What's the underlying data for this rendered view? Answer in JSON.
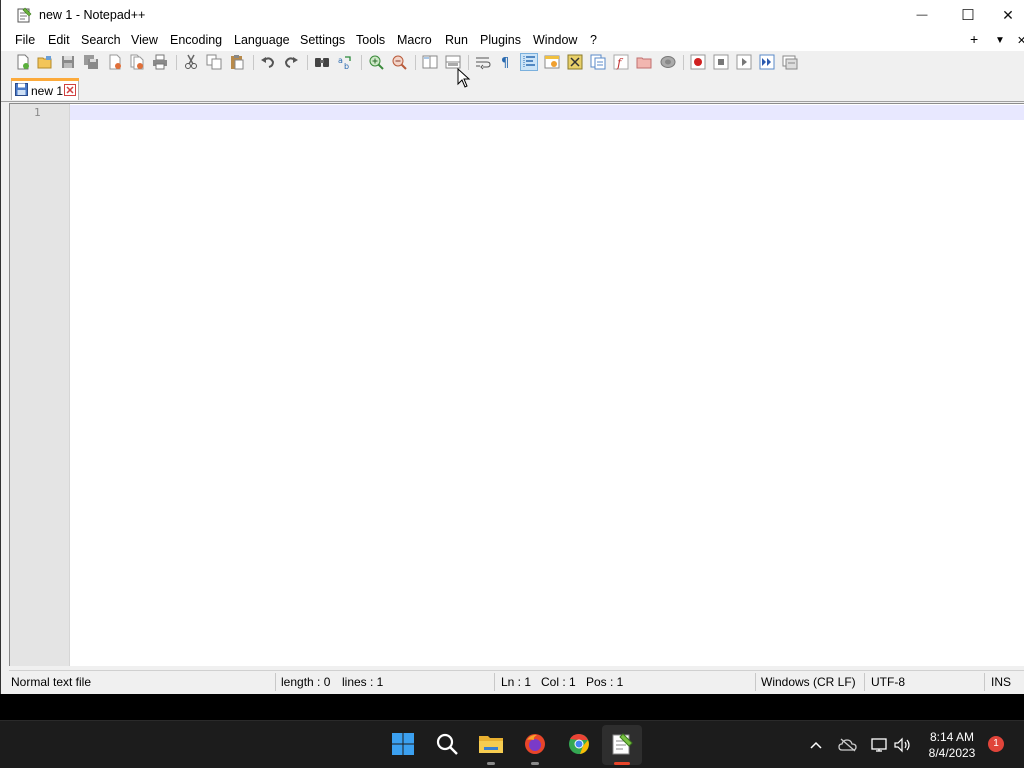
{
  "window": {
    "title": "new 1 - Notepad++",
    "minimize_glyph": "—",
    "maximize_glyph": "☐",
    "close_glyph": "✕"
  },
  "menu": {
    "items": [
      "File",
      "Edit",
      "Search",
      "View",
      "Encoding",
      "Language",
      "Settings",
      "Tools",
      "Macro",
      "Run",
      "Plugins",
      "Window",
      "?"
    ],
    "add_tab_glyph": "+",
    "tab_list_glyph": "▼",
    "close_doc_glyph": "✕"
  },
  "toolbar": {
    "icons": [
      "new-file-icon",
      "open-file-icon",
      "save-icon",
      "save-all-icon",
      "close-icon",
      "close-all-icon",
      "print-icon",
      "cut-icon",
      "copy-icon",
      "paste-icon",
      "undo-icon",
      "redo-icon",
      "find-icon",
      "replace-icon",
      "zoom-in-icon",
      "zoom-out-icon",
      "sync-vertical-icon",
      "sync-horizontal-icon",
      "word-wrap-icon",
      "show-all-characters-icon",
      "indent-guide-icon",
      "user-defined-language-icon",
      "document-map-icon",
      "document-list-icon",
      "function-list-icon",
      "folder-as-workspace-icon",
      "monitoring-icon",
      "start-recording-icon",
      "stop-recording-icon",
      "playback-icon",
      "run-macro-multiple-icon",
      "save-macro-icon"
    ]
  },
  "tabs": [
    {
      "label": "new 1",
      "active": true
    }
  ],
  "editor": {
    "line_numbers": [
      "1"
    ],
    "content": ""
  },
  "status": {
    "file_type": "Normal text file",
    "length": "length : 0",
    "lines": "lines : 1",
    "ln": "Ln : 1",
    "col": "Col : 1",
    "pos": "Pos : 1",
    "eol": "Windows (CR LF)",
    "encoding": "UTF-8",
    "mode": "INS"
  },
  "taskbar": {
    "apps": [
      "start-button",
      "search",
      "file-explorer",
      "firefox",
      "chrome",
      "notepad-plus-plus"
    ],
    "tray": {
      "chevron_glyph": "^",
      "time": "8:14 AM",
      "date": "8/4/2023",
      "notification_count": "1"
    }
  },
  "colors": {
    "tab_accent": "#fcaa3b",
    "current_line": "#e8e8ff",
    "gutter": "#e4e4e4",
    "taskbar": "#1c1c1c"
  }
}
